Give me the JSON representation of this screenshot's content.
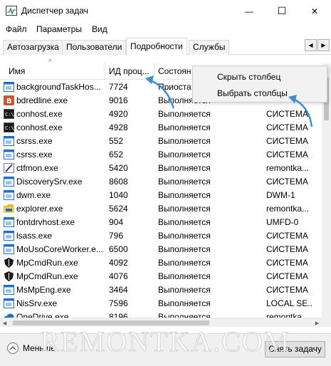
{
  "window": {
    "title": "Диспетчер задач",
    "minimize_glyph": "—",
    "maximize_glyph": "☐",
    "close_glyph": "✕"
  },
  "menu": [
    "Файл",
    "Параметры",
    "Вид"
  ],
  "tabs": [
    {
      "label": "Автозагрузка",
      "active": false
    },
    {
      "label": "Пользователи",
      "active": false
    },
    {
      "label": "Подробности",
      "active": true
    },
    {
      "label": "Службы",
      "active": false
    }
  ],
  "tab_scroll": {
    "left": "◀",
    "right": "▶"
  },
  "columns": {
    "name": "Имя",
    "pid": "ИД проц...",
    "status": "Состоян",
    "sort_glyph": "^"
  },
  "context_menu": {
    "hide_column": "Скрыть столбец",
    "select_columns": "Выбрать столбцы"
  },
  "rows": [
    {
      "name": "backgroundTaskHos...",
      "pid": "7724",
      "status": "Приоста",
      "user": "",
      "icon": "window-icon"
    },
    {
      "name": "bdredline.exe",
      "pid": "9016",
      "status": "Выполняется",
      "user": "",
      "icon": "brand-b-icon"
    },
    {
      "name": "conhost.exe",
      "pid": "4920",
      "status": "Выполняется",
      "user": "СИСТЕМА",
      "icon": "console-icon"
    },
    {
      "name": "conhost.exe",
      "pid": "4928",
      "status": "Выполняется",
      "user": "СИСТЕМА",
      "icon": "console-icon"
    },
    {
      "name": "csrss.exe",
      "pid": "552",
      "status": "Выполняется",
      "user": "СИСТЕМА",
      "icon": "window-icon"
    },
    {
      "name": "csrss.exe",
      "pid": "652",
      "status": "Выполняется",
      "user": "СИСТЕМА",
      "icon": "window-icon"
    },
    {
      "name": "ctfmon.exe",
      "pid": "5420",
      "status": "Выполняется",
      "user": "remontka...",
      "icon": "pen-icon"
    },
    {
      "name": "DiscoverySrv.exe",
      "pid": "8608",
      "status": "Выполняется",
      "user": "СИСТЕМА",
      "icon": "window-icon"
    },
    {
      "name": "dwm.exe",
      "pid": "1040",
      "status": "Выполняется",
      "user": "DWM-1",
      "icon": "window-icon"
    },
    {
      "name": "explorer.exe",
      "pid": "5624",
      "status": "Выполняется",
      "user": "remontka...",
      "icon": "folder-icon"
    },
    {
      "name": "fontdrvhost.exe",
      "pid": "904",
      "status": "Выполняется",
      "user": "UMFD-0",
      "icon": "window-icon"
    },
    {
      "name": "lsass.exe",
      "pid": "796",
      "status": "Выполняется",
      "user": "СИСТЕМА",
      "icon": "window-icon"
    },
    {
      "name": "MoUsoCoreWorker.e...",
      "pid": "6500",
      "status": "Выполняется",
      "user": "СИСТЕМА",
      "icon": "window-icon"
    },
    {
      "name": "MpCmdRun.exe",
      "pid": "4092",
      "status": "Выполняется",
      "user": "СИСТЕМА",
      "icon": "shield-icon"
    },
    {
      "name": "MpCmdRun.exe",
      "pid": "4076",
      "status": "Выполняется",
      "user": "СИСТЕМА",
      "icon": "shield-icon"
    },
    {
      "name": "MsMpEng.exe",
      "pid": "3464",
      "status": "Выполняется",
      "user": "СИСТЕМА",
      "icon": "window-icon"
    },
    {
      "name": "NisSrv.exe",
      "pid": "7596",
      "status": "Выполняется",
      "user": "LOCAL SE...",
      "icon": "window-icon"
    },
    {
      "name": "OneDrive.exe",
      "pid": "8196",
      "status": "Выполняется",
      "user": "remontka...",
      "icon": "cloud-icon"
    }
  ],
  "footer": {
    "fewer_details": "Меньше",
    "end_task": "Снять задачу",
    "watermark": "REMONTKA.COM"
  },
  "colors": {
    "accent_arrow": "#3b8ed8",
    "process_icon_blue": "#1f6fc5",
    "brand_b": "#d2522b",
    "folder": "#e8b735"
  }
}
